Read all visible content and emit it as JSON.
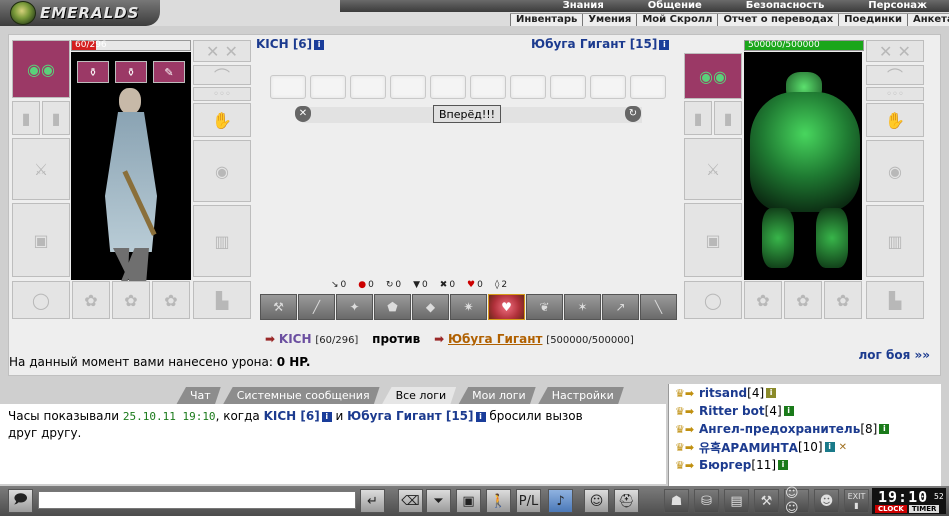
{
  "header": {
    "logo_text": "EMERALDS",
    "top_menu": [
      "Знания",
      "Общение",
      "Безопасность",
      "Персонаж"
    ],
    "sub_menu": [
      "Инвентарь",
      "Умения",
      "Мой Скролл",
      "Отчет о переводах",
      "Поединки",
      "Анкета"
    ]
  },
  "player": {
    "name": "KICH",
    "level": "[6]",
    "hp_text": "60/296",
    "hp_fraction": 0.2,
    "hp_color": "#d42020"
  },
  "enemy": {
    "name": "Юбуга Гигант",
    "level": "[15]",
    "hp_text": "500000/500000",
    "hp_fraction": 1.0,
    "hp_color": "#1aa61a"
  },
  "battle": {
    "forward_button": "Вперёд!!!",
    "stats": [
      "0",
      "0",
      "0",
      "0",
      "0",
      "0",
      "2"
    ],
    "vs_player_hp": "[60/296]",
    "vs_word": "против",
    "vs_enemy_hp": "[500000/500000]",
    "damage_text": "На данный момент вами нанесено урона:",
    "damage_value": "0 HP.",
    "battle_log_link": "лог боя »»"
  },
  "tabs": [
    "Чат",
    "Системные сообщения",
    "Все логи",
    "Мои логи",
    "Настройки"
  ],
  "active_tab": "Все логи",
  "chat": {
    "line1_prefix": "Часы показывали",
    "line1_time": "25.10.11 19:10",
    "line1_mid": ", когда",
    "line1_player": "KICH [6]",
    "line1_and": "и",
    "line1_enemy": "Юбуга Гигант [15]",
    "line1_suffix": "бросили вызов",
    "line2": "друг другу."
  },
  "players": [
    {
      "name": "ritsand",
      "rank": "[4]"
    },
    {
      "name": "Ritter bot",
      "rank": "[4]"
    },
    {
      "name": "Ангел-предохранитель",
      "rank": "[8]"
    },
    {
      "name": "유혹АРАМИНТА",
      "rank": "[10]"
    },
    {
      "name": "Бюргер",
      "rank": "[11]"
    }
  ],
  "bottom": {
    "input_placeholder": "",
    "exit_label": "EXIT",
    "clock_time": "19:10",
    "clock_seconds": "52",
    "clock_label": "CLOCK",
    "timer_label": "TIMER"
  }
}
